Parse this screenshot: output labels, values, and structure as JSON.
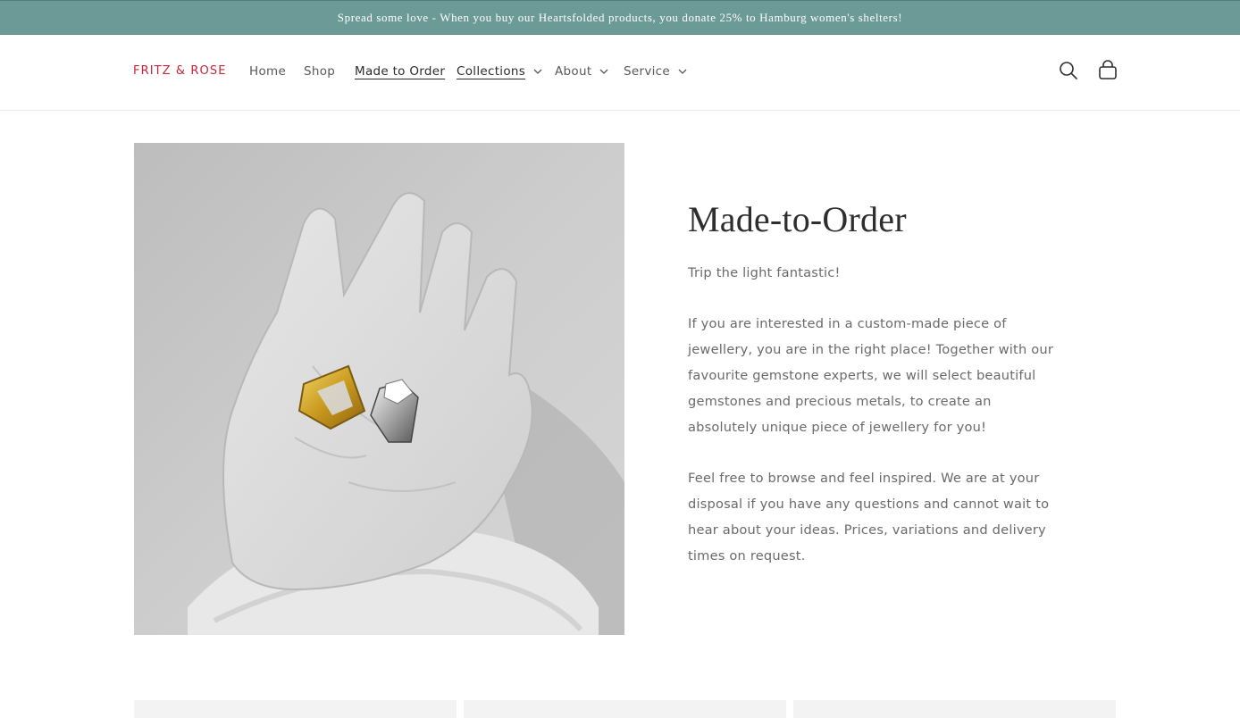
{
  "announcement": {
    "text": "Spread some love - When you buy our Heartsfolded products, you donate 25% to Hamburg women's shelters!"
  },
  "header": {
    "logo": "FRITZ & ROSE",
    "nav": [
      {
        "label": "Home"
      },
      {
        "label": "Shop"
      },
      {
        "label": "Made to Order"
      },
      {
        "label": "Collections"
      },
      {
        "label": "About"
      },
      {
        "label": "Service"
      }
    ],
    "icons": {
      "search": "search-icon",
      "cart": "cart-icon"
    }
  },
  "main": {
    "title": "Made-to-Order",
    "paragraphs": [
      "Trip the light fantastic!",
      "If you are interested in a custom-made piece of jewellery, you are in the right place! Together with our favourite gemstone experts, we will select beautiful gemstones and precious metals, to create an absolutely unique piece of jewellery for you!",
      "Feel free to browse and feel inspired. We are at your disposal if you have any questions and cannot wait to hear about your ideas. Prices, variations and delivery times on request."
    ]
  },
  "colors": {
    "announcement_bg": "#6b9a97",
    "logo": "#c8243a"
  }
}
